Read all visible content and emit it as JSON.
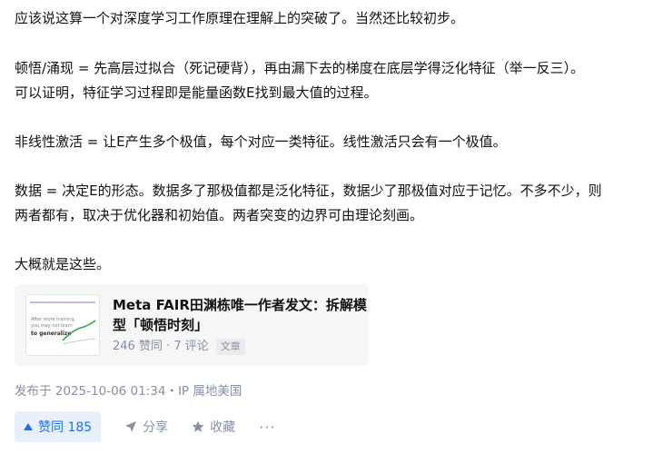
{
  "paragraphs": [
    [
      "应该说这算一个对深度学习工作原理在理解上的突破了。当然还比较初步。"
    ],
    [
      "顿悟/涌现 = 先高层过拟合（死记硬背），再由漏下去的梯度在底层学得泛化特征（举一反三）。",
      "可以证明，特征学习过程即是能量函数E找到最大值的过程。"
    ],
    [
      "非线性激活 = 让E产生多个极值，每个对应一类特征。线性激活只会有一个极值。"
    ],
    [
      "数据 = 决定E的形态。数据多了那极值都是泛化特征，数据少了那极值对应于记忆。不多不少，则",
      "两者都有，取决于优化器和初始值。两者突变的边界可由理论刻画。"
    ],
    [
      "大概就是这些。"
    ]
  ],
  "link_card": {
    "title": "Meta FAIR田渊栋唯一作者发文：拆解模型「顿悟时刻」",
    "stats": "246 赞同 · 7 评论",
    "tag": "文章",
    "thumb_lines": [
      "After more training,",
      "you may not learn",
      "to generalize"
    ]
  },
  "publish_info": "发布于 2025-10-06 01:34・IP 属地美国",
  "actions": {
    "vote": "赞同 185",
    "share": "分享",
    "favorite": "收藏",
    "more": "···"
  },
  "colors": {
    "accent": "#1772f6",
    "muted": "#8590a6",
    "card_bg": "#f6f6f6"
  }
}
